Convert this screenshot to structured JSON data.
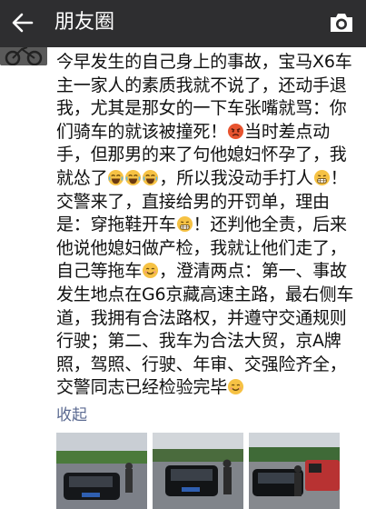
{
  "header": {
    "title": "朋友圈",
    "back_icon": "back-arrow-icon",
    "camera_icon": "camera-icon"
  },
  "post": {
    "segments": [
      {
        "t": "今早发生的自己身上的事故，宝马X6车主一家人的素质我就不说了，还动手退我，尤其是那女的一下车张嘴就骂：你们骑车的就该被撞死！"
      },
      {
        "e": "angry"
      },
      {
        "t": "当时差点动手，但那男的来了句他媳妇怀孕了，我就怂了"
      },
      {
        "e": "laugh"
      },
      {
        "e": "laugh"
      },
      {
        "e": "laugh"
      },
      {
        "t": "，所以我没动手打人"
      },
      {
        "e": "grin"
      },
      {
        "t": "！交警来了，直接给男的开罚单，理由是：穿拖鞋开车"
      },
      {
        "e": "grin"
      },
      {
        "t": "！还判他全责，后来他说他媳妇做产检，我就让他们走了，自己等拖车"
      },
      {
        "e": "smile"
      },
      {
        "t": "，澄清两点：第一、事故发生地点在G6京藏高速主路，最右侧车道，我拥有合法路权，并遵守交通规则行驶；第二、我车为合法大贸，京A牌照，驾照、行驶、年审、交强险齐全，交警同志已经检验完毕"
      },
      {
        "e": "smile"
      }
    ],
    "collapse_label": "收起"
  },
  "colors": {
    "topbar": "#2e2e30",
    "link": "#5b6a91"
  }
}
